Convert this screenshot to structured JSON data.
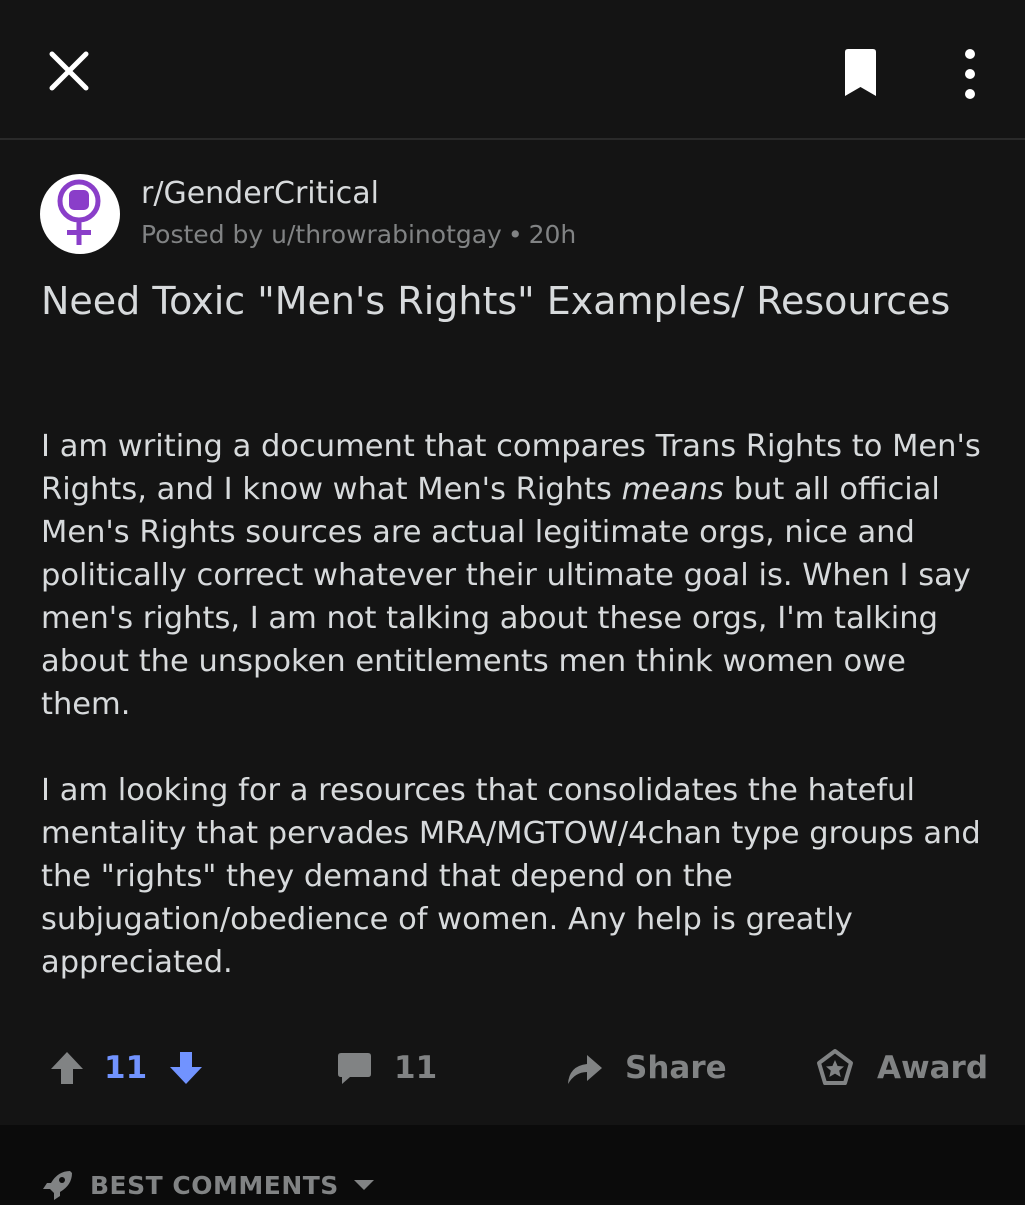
{
  "header": {
    "close_icon": "close-icon",
    "bookmark_icon": "bookmark-icon",
    "more_icon": "more-vertical-icon"
  },
  "post": {
    "subreddit": "r/GenderCritical",
    "posted_by_prefix": "Posted by",
    "author": "u/throwrabinotgay",
    "separator": "•",
    "age": "20h",
    "avatar_icon": "female-symbol-fist-icon",
    "avatar_color": "#8a3ec9",
    "title": "Need Toxic \"Men's Rights\" Examples/ Resources",
    "body_p1_before": "I am writing a document that compares Trans Rights to Men's Rights, and I know what Men's Rights ",
    "body_p1_emph": "means",
    "body_p1_after": " but all official Men's Rights sources are actual legitimate orgs, nice and politically correct whatever their ultimate goal is. When I say men's rights, I am not talking about these orgs, I'm talking about the unspoken entitlements men think women owe them.",
    "body_p2": "I am looking for a resources that consolidates the hateful mentality that pervades MRA/MGTOW/4chan type groups and the \"rights\" they demand that depend on the subjugation/obedience of women. Any help is greatly appreciated."
  },
  "actions": {
    "upvote_icon": "arrow-up-icon",
    "vote_count": "11",
    "downvote_icon": "arrow-down-icon",
    "downvote_color": "#7193ff",
    "comment_icon": "comment-icon",
    "comment_count": "11",
    "share_icon": "share-icon",
    "share_label": "Share",
    "award_icon": "award-icon",
    "award_label": "Award"
  },
  "comments_sort": {
    "icon": "rocket-icon",
    "label": "BEST COMMENTS",
    "caret_icon": "caret-down-icon"
  }
}
